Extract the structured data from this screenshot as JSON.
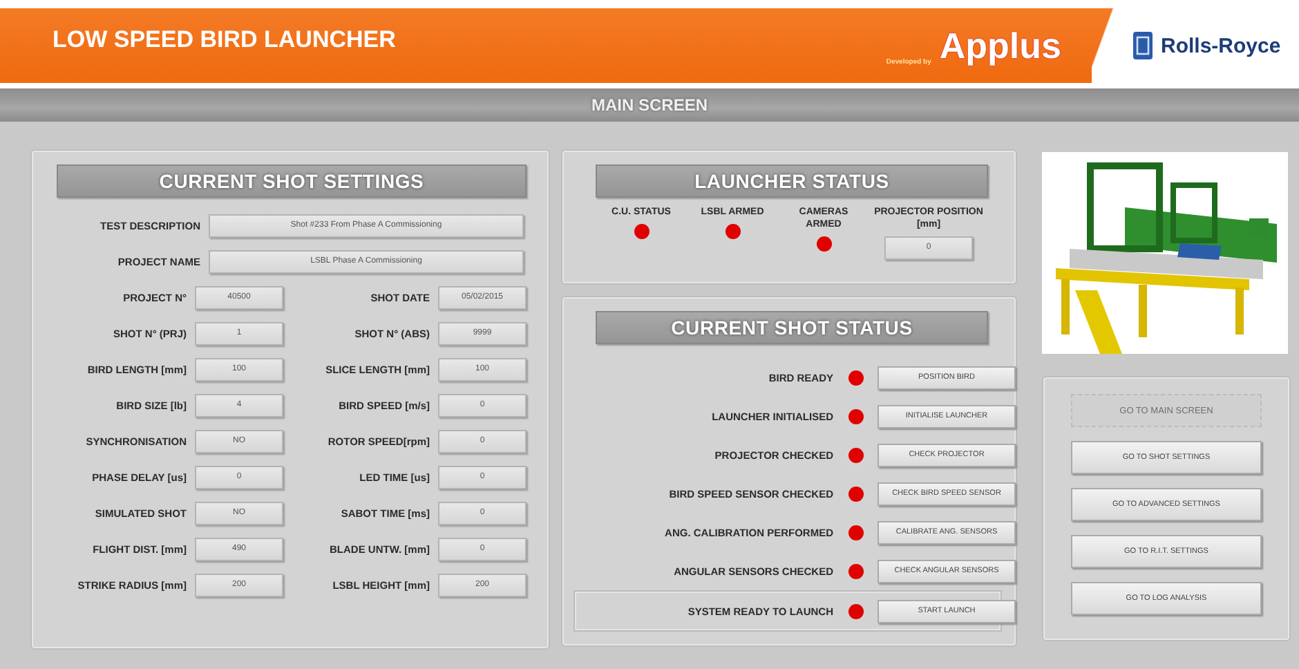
{
  "header": {
    "title": "LOW SPEED BIRD LAUNCHER",
    "developed_by": "Developed by",
    "developer": "Applus",
    "partner": "Rolls-Royce"
  },
  "screen_title": "MAIN SCREEN",
  "shot_settings": {
    "title": "CURRENT SHOT SETTINGS",
    "wide_fields": [
      {
        "label": "TEST DESCRIPTION",
        "value": "Shot #233 From Phase A Commissioning"
      },
      {
        "label": "PROJECT NAME",
        "value": "LSBL Phase A Commissioning"
      }
    ],
    "fields": [
      {
        "label": "PROJECT N°",
        "value": "40500"
      },
      {
        "label": "SHOT DATE",
        "value": "05/02/2015"
      },
      {
        "label": "SHOT N° (PRJ)",
        "value": "1"
      },
      {
        "label": "SHOT N° (ABS)",
        "value": "9999"
      },
      {
        "label": "BIRD LENGTH [mm]",
        "value": "100"
      },
      {
        "label": "SLICE LENGTH [mm]",
        "value": "100"
      },
      {
        "label": "BIRD SIZE [lb]",
        "value": "4"
      },
      {
        "label": "BIRD SPEED [m/s]",
        "value": "0"
      },
      {
        "label": "SYNCHRONISATION",
        "value": "NO"
      },
      {
        "label": "ROTOR SPEED[rpm]",
        "value": "0"
      },
      {
        "label": "PHASE DELAY [us]",
        "value": "0"
      },
      {
        "label": "LED TIME [us]",
        "value": "0"
      },
      {
        "label": "SIMULATED SHOT",
        "value": "NO"
      },
      {
        "label": "SABOT TIME [ms]",
        "value": "0"
      },
      {
        "label": "FLIGHT DIST. [mm]",
        "value": "490"
      },
      {
        "label": "BLADE UNTW. [mm]",
        "value": "0"
      },
      {
        "label": "STRIKE RADIUS [mm]",
        "value": "200"
      },
      {
        "label": "LSBL HEIGHT [mm]",
        "value": "200"
      }
    ]
  },
  "launcher_status": {
    "title": "LAUNCHER STATUS",
    "indicators": [
      {
        "label": "C.U. STATUS",
        "ok": false
      },
      {
        "label": "LSBL ARMED",
        "ok": false
      },
      {
        "label": "CAMERAS ARMED",
        "ok": false
      }
    ],
    "projector": {
      "label": "PROJECTOR POSITION [mm]",
      "value": "0"
    }
  },
  "shot_status": {
    "title": "CURRENT SHOT STATUS",
    "steps": [
      {
        "label": "BIRD READY",
        "ok": false,
        "button": "POSITION BIRD"
      },
      {
        "label": "LAUNCHER INITIALISED",
        "ok": false,
        "button": "INITIALISE LAUNCHER"
      },
      {
        "label": "PROJECTOR CHECKED",
        "ok": false,
        "button": "CHECK PROJECTOR"
      },
      {
        "label": "BIRD SPEED SENSOR CHECKED",
        "ok": false,
        "button": "CHECK BIRD SPEED SENSOR"
      },
      {
        "label": "ANG. CALIBRATION PERFORMED",
        "ok": false,
        "button": "CALIBRATE ANG. SENSORS"
      },
      {
        "label": "ANGULAR SENSORS CHECKED",
        "ok": false,
        "button": "CHECK ANGULAR SENSORS"
      }
    ],
    "launch": {
      "label": "SYSTEM READY TO LAUNCH",
      "ok": false,
      "button": "START LAUNCH"
    }
  },
  "navigation": [
    {
      "label": "GO TO MAIN SCREEN",
      "disabled": true
    },
    {
      "label": "GO TO SHOT SETTINGS",
      "disabled": false
    },
    {
      "label": "GO TO ADVANCED SETTINGS",
      "disabled": false
    },
    {
      "label": "GO TO R.I.T. SETTINGS",
      "disabled": false
    },
    {
      "label": "GO TO LOG ANALYSIS",
      "disabled": false
    }
  ]
}
